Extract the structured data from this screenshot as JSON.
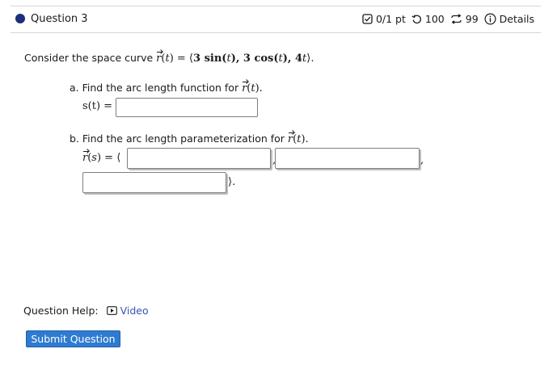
{
  "header": {
    "question_title": "Question 3",
    "score": "0/1 pt",
    "retries": "100",
    "attempts": "99",
    "details_label": "Details"
  },
  "question": {
    "prompt_prefix": "Consider the space curve",
    "part_a": {
      "label": "a. Find the arc length function for",
      "answer_label": "s(t) =",
      "answer_value": ""
    },
    "part_b": {
      "label": "b. Find the arc length parameterization for",
      "component1": "",
      "component2": "",
      "component3": ""
    }
  },
  "help": {
    "label": "Question Help:",
    "video_label": "Video"
  },
  "submit_label": "Submit Question",
  "colors": {
    "accent_dot": "#1b2f7a",
    "submit_bg": "#2e7bd1",
    "link": "#3753b4"
  }
}
